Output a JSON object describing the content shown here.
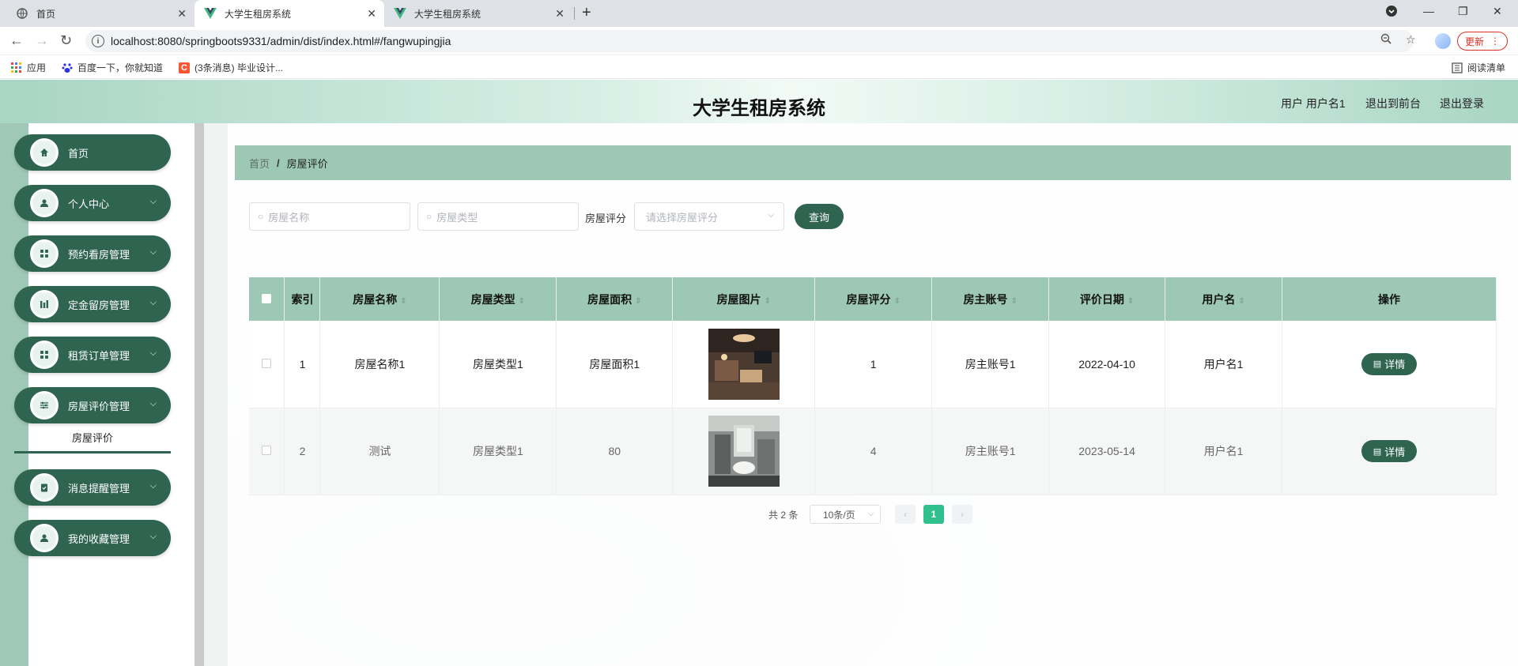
{
  "browser": {
    "tabs": [
      {
        "title": "首页",
        "active": false
      },
      {
        "title": "大学生租房系统",
        "active": true
      },
      {
        "title": "大学生租房系统",
        "active": false
      }
    ],
    "url": "localhost:8080/springboots9331/admin/dist/index.html#/fangwupingjia",
    "update_label": "更新",
    "bookmarks": [
      "应用",
      "百度一下，你就知道",
      "(3条消息) 毕业设计..."
    ],
    "reading_list": "阅读清单"
  },
  "header": {
    "title": "大学生租房系统",
    "user_label": "用户 用户名1",
    "front_label": "退出到前台",
    "logout_label": "退出登录"
  },
  "sidebar": {
    "items": [
      {
        "label": "首页",
        "icon": "home-icon"
      },
      {
        "label": "个人中心",
        "icon": "user-icon"
      },
      {
        "label": "预约看房管理",
        "icon": "grid-icon"
      },
      {
        "label": "定金留房管理",
        "icon": "bars-icon"
      },
      {
        "label": "租赁订单管理",
        "icon": "grid-icon"
      },
      {
        "label": "房屋评价管理",
        "icon": "sliders-icon"
      },
      {
        "label": "消息提醒管理",
        "icon": "clipboard-check-icon"
      },
      {
        "label": "我的收藏管理",
        "icon": "user-icon"
      }
    ],
    "sub_item": "房屋评价"
  },
  "breadcrumb": {
    "home": "首页",
    "current": "房屋评价"
  },
  "search": {
    "name_placeholder": "房屋名称",
    "type_placeholder": "房屋类型",
    "rating_label": "房屋评分",
    "rating_placeholder": "请选择房屋评分",
    "query_label": "查询"
  },
  "table": {
    "headers": [
      "索引",
      "房屋名称",
      "房屋类型",
      "房屋面积",
      "房屋图片",
      "房屋评分",
      "房主账号",
      "评价日期",
      "用户名",
      "操作"
    ],
    "rows": [
      {
        "index": "1",
        "name": "房屋名称1",
        "type": "房屋类型1",
        "area": "房屋面积1",
        "image": "hotel-room-photo",
        "rating": "1",
        "owner": "房主账号1",
        "date": "2022-04-10",
        "user": "用户名1"
      },
      {
        "index": "2",
        "name": "测试",
        "type": "房屋类型1",
        "area": "80",
        "image": "bathroom-photo",
        "rating": "4",
        "owner": "房主账号1",
        "date": "2023-05-14",
        "user": "用户名1"
      }
    ],
    "detail_label": "详情"
  },
  "pagination": {
    "total": "共 2 条",
    "page_size": "10条/页",
    "current_page": "1"
  },
  "colors": {
    "primary": "#2e6450",
    "header_bg": "#9cc8b5",
    "active_page": "#2fc08d"
  }
}
